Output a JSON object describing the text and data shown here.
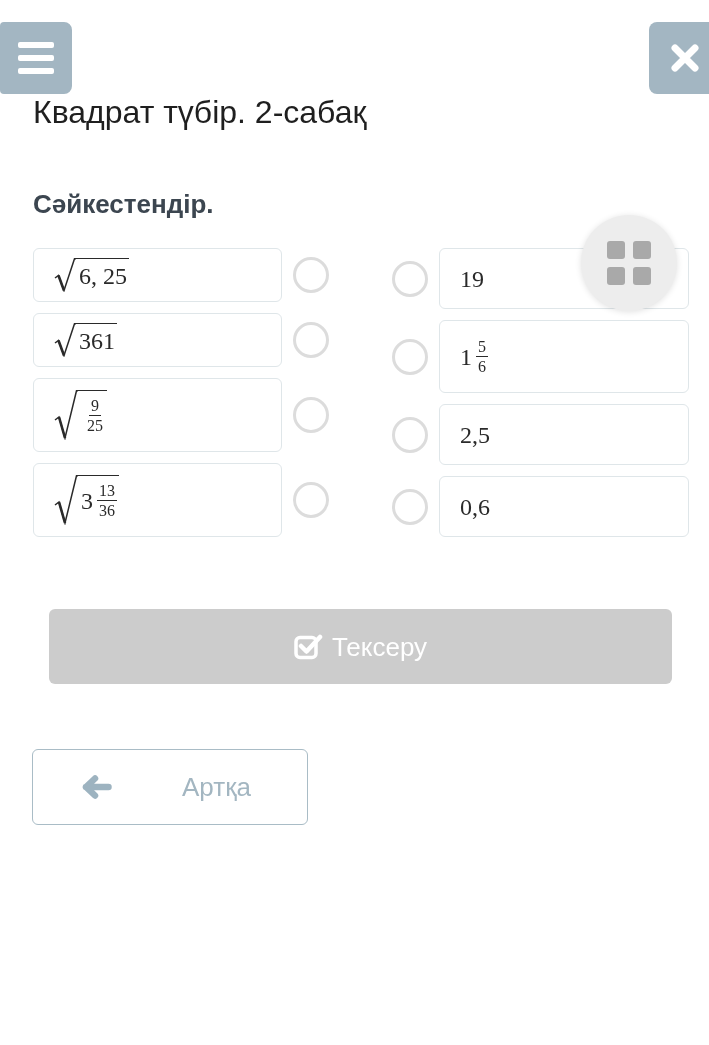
{
  "lesson_title": "Квадрат түбір. 2-сабақ",
  "task": {
    "instruction": "Сәйкестендір.",
    "left_items": [
      {
        "radical": true,
        "whole": "6, 25",
        "selected": false
      },
      {
        "radical": true,
        "whole": "361",
        "selected": false
      },
      {
        "radical": true,
        "numerator": "9",
        "denominator": "25",
        "selected": false
      },
      {
        "radical": true,
        "whole": "3",
        "numerator": "13",
        "denominator": "36",
        "selected": false
      }
    ],
    "right_items": [
      {
        "radical": false,
        "whole": "19",
        "selected": false
      },
      {
        "radical": false,
        "whole": "1",
        "numerator": "5",
        "denominator": "6",
        "selected": false
      },
      {
        "radical": false,
        "whole": "2,5",
        "selected": false
      },
      {
        "radical": false,
        "whole": "0,6",
        "selected": false
      }
    ]
  },
  "check_button": {
    "label": "Тексеру",
    "disabled": true
  },
  "back_button": {
    "label": "Артқа"
  }
}
